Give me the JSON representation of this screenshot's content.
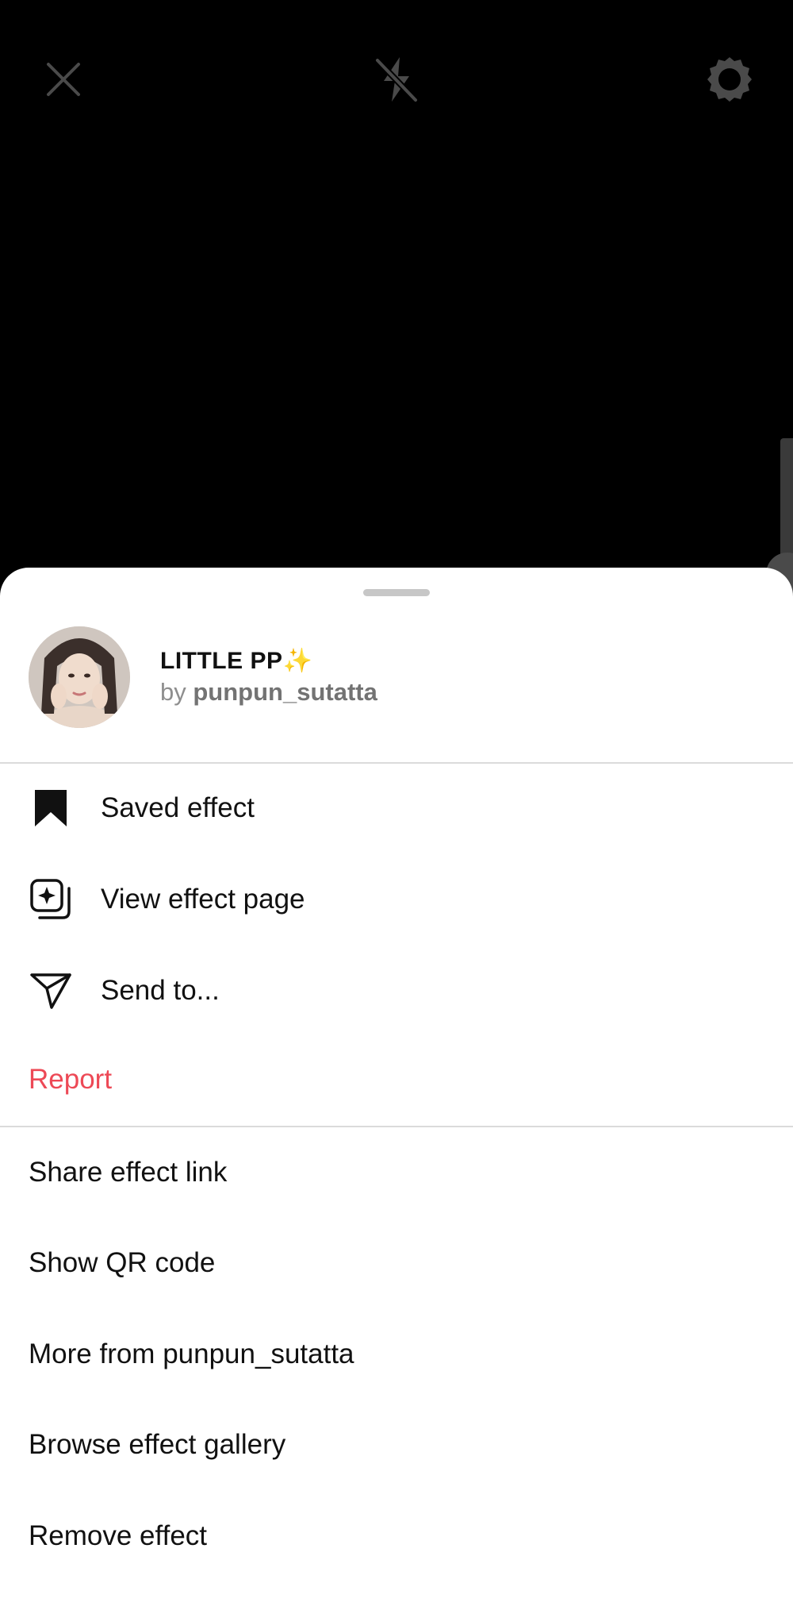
{
  "camera": {
    "close_icon": "close-icon",
    "flash_icon": "flash-off-icon",
    "settings_icon": "settings-gear-icon"
  },
  "effect": {
    "title": "LITTLE PP✨",
    "by_prefix": "by",
    "creator": "punpun_sutatta"
  },
  "actions": [
    {
      "label": "Saved effect",
      "icon": "bookmark-filled-icon"
    },
    {
      "label": "View effect page",
      "icon": "effect-page-icon"
    },
    {
      "label": "Send to...",
      "icon": "send-paper-plane-icon"
    },
    {
      "label": "Report",
      "icon": ""
    }
  ],
  "more_actions": [
    {
      "label": "Share effect link"
    },
    {
      "label": "Show QR code"
    },
    {
      "label": "More from punpun_sutatta"
    },
    {
      "label": "Browse effect gallery"
    },
    {
      "label": "Remove effect"
    }
  ],
  "colors": {
    "danger": "#ed4956",
    "sheet_bg": "#ffffff",
    "camera_bg": "#000000"
  }
}
